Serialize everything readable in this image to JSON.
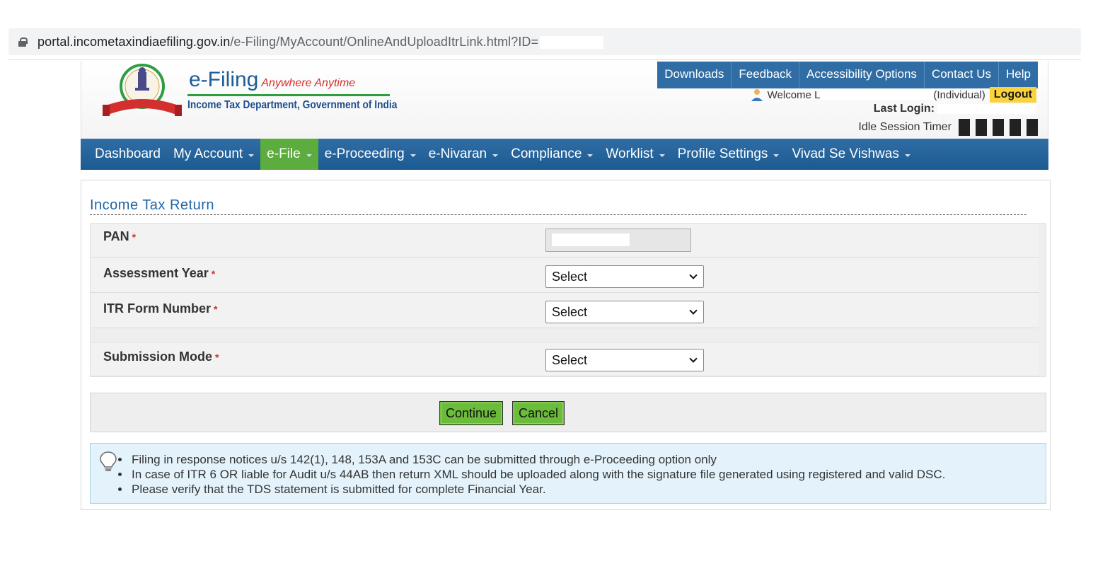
{
  "browser": {
    "url_host": "portal.incometaxindiaefiling.gov.in",
    "url_path": "/e-Filing/MyAccount/OnlineAndUploadItrLink.html?ID="
  },
  "header": {
    "title": "e-Filing",
    "tagline": "Anywhere Anytime",
    "subtitle": "Income Tax Department, Government of India",
    "top_links": [
      "Downloads",
      "Feedback",
      "Accessibility Options",
      "Contact Us",
      "Help"
    ],
    "welcome_prefix": "Welcome L",
    "welcome_suffix": "(Individual)",
    "logout": "Logout",
    "last_login_label": "Last Login:",
    "idle_label": "Idle Session Timer"
  },
  "nav": {
    "items": [
      {
        "label": "Dashboard",
        "caret": false,
        "active": false
      },
      {
        "label": "My Account",
        "caret": true,
        "active": false
      },
      {
        "label": "e-File",
        "caret": true,
        "active": true
      },
      {
        "label": "e-Proceeding",
        "caret": true,
        "active": false
      },
      {
        "label": "e-Nivaran",
        "caret": true,
        "active": false
      },
      {
        "label": "Compliance",
        "caret": true,
        "active": false
      },
      {
        "label": "Worklist",
        "caret": true,
        "active": false
      },
      {
        "label": "Profile Settings",
        "caret": true,
        "active": false
      },
      {
        "label": "Vivad Se Vishwas",
        "caret": true,
        "active": false
      }
    ]
  },
  "form": {
    "section_title": "Income Tax Return",
    "pan_label": "PAN",
    "assessment_year_label": "Assessment Year",
    "itr_form_label": "ITR Form Number",
    "submission_mode_label": "Submission Mode",
    "required_mark": "*",
    "assessment_year_value": "Select",
    "itr_form_value": "Select",
    "submission_mode_value": "Select",
    "continue_label": "Continue",
    "cancel_label": "Cancel"
  },
  "info": {
    "notes": [
      "Filing in response notices u/s 142(1), 148, 153A and 153C can be submitted through e-Proceeding option only",
      "In case of ITR 6 OR liable for Audit u/s 44AB then return XML should be uploaded along with the signature file generated using registered and valid DSC.",
      "Please verify that the TDS statement is submitted for complete Financial Year."
    ]
  },
  "colors": {
    "nav_blue": "#2f6da4",
    "active_green": "#5cac3e",
    "button_green": "#6cbc3c",
    "logout_yellow": "#f9d23c",
    "info_bg": "#e4f3fb"
  }
}
